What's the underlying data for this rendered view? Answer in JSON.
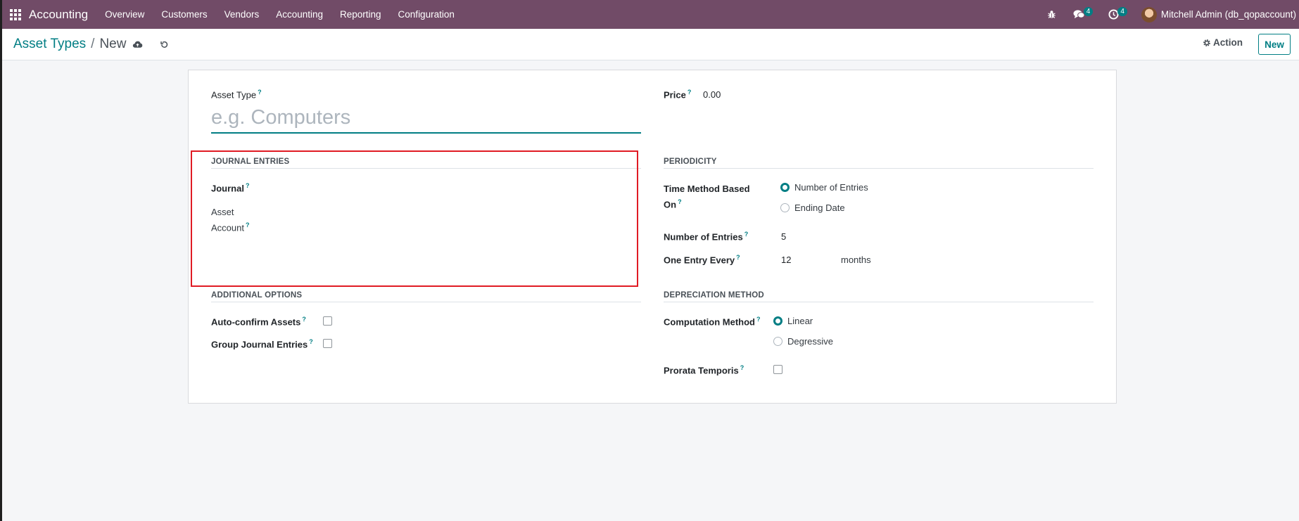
{
  "navbar": {
    "app_name": "Accounting",
    "menu": [
      "Overview",
      "Customers",
      "Vendors",
      "Accounting",
      "Reporting",
      "Configuration"
    ],
    "messages_count": "4",
    "activities_count": "4",
    "user": "Mitchell Admin (db_qopaccount)"
  },
  "breadcrumb": {
    "parent": "Asset Types",
    "separator": "/",
    "current": "New"
  },
  "toolbar": {
    "action_label": "Action",
    "new_label": "New"
  },
  "form": {
    "asset_type": {
      "label": "Asset Type",
      "placeholder": "e.g. Computers"
    },
    "price": {
      "label": "Price",
      "value": "0.00"
    },
    "journal_entries": {
      "title": "JOURNAL ENTRIES",
      "journal_label": "Journal",
      "asset_account_label_1": "Asset",
      "asset_account_label_2": "Account"
    },
    "periodicity": {
      "title": "PERIODICITY",
      "time_method_label_1": "Time Method Based",
      "time_method_label_2": "On",
      "options": [
        "Number of Entries",
        "Ending Date"
      ],
      "selected": "Number of Entries",
      "number_of_entries_label": "Number of Entries",
      "number_of_entries_value": "5",
      "one_entry_every_label": "One Entry Every",
      "one_entry_every_value": "12",
      "one_entry_every_unit": "months"
    },
    "additional_options": {
      "title": "ADDITIONAL OPTIONS",
      "auto_confirm_label": "Auto-confirm Assets",
      "auto_confirm_checked": false,
      "group_journal_label": "Group Journal Entries",
      "group_journal_checked": false
    },
    "depreciation": {
      "title": "DEPRECIATION METHOD",
      "computation_label": "Computation Method",
      "options": [
        "Linear",
        "Degressive"
      ],
      "selected": "Linear",
      "prorata_label": "Prorata Temporis",
      "prorata_checked": false
    },
    "help_marker": "?"
  },
  "colors": {
    "navbar": "#714b67",
    "accent": "#017e84",
    "highlight": "#e01b24"
  }
}
